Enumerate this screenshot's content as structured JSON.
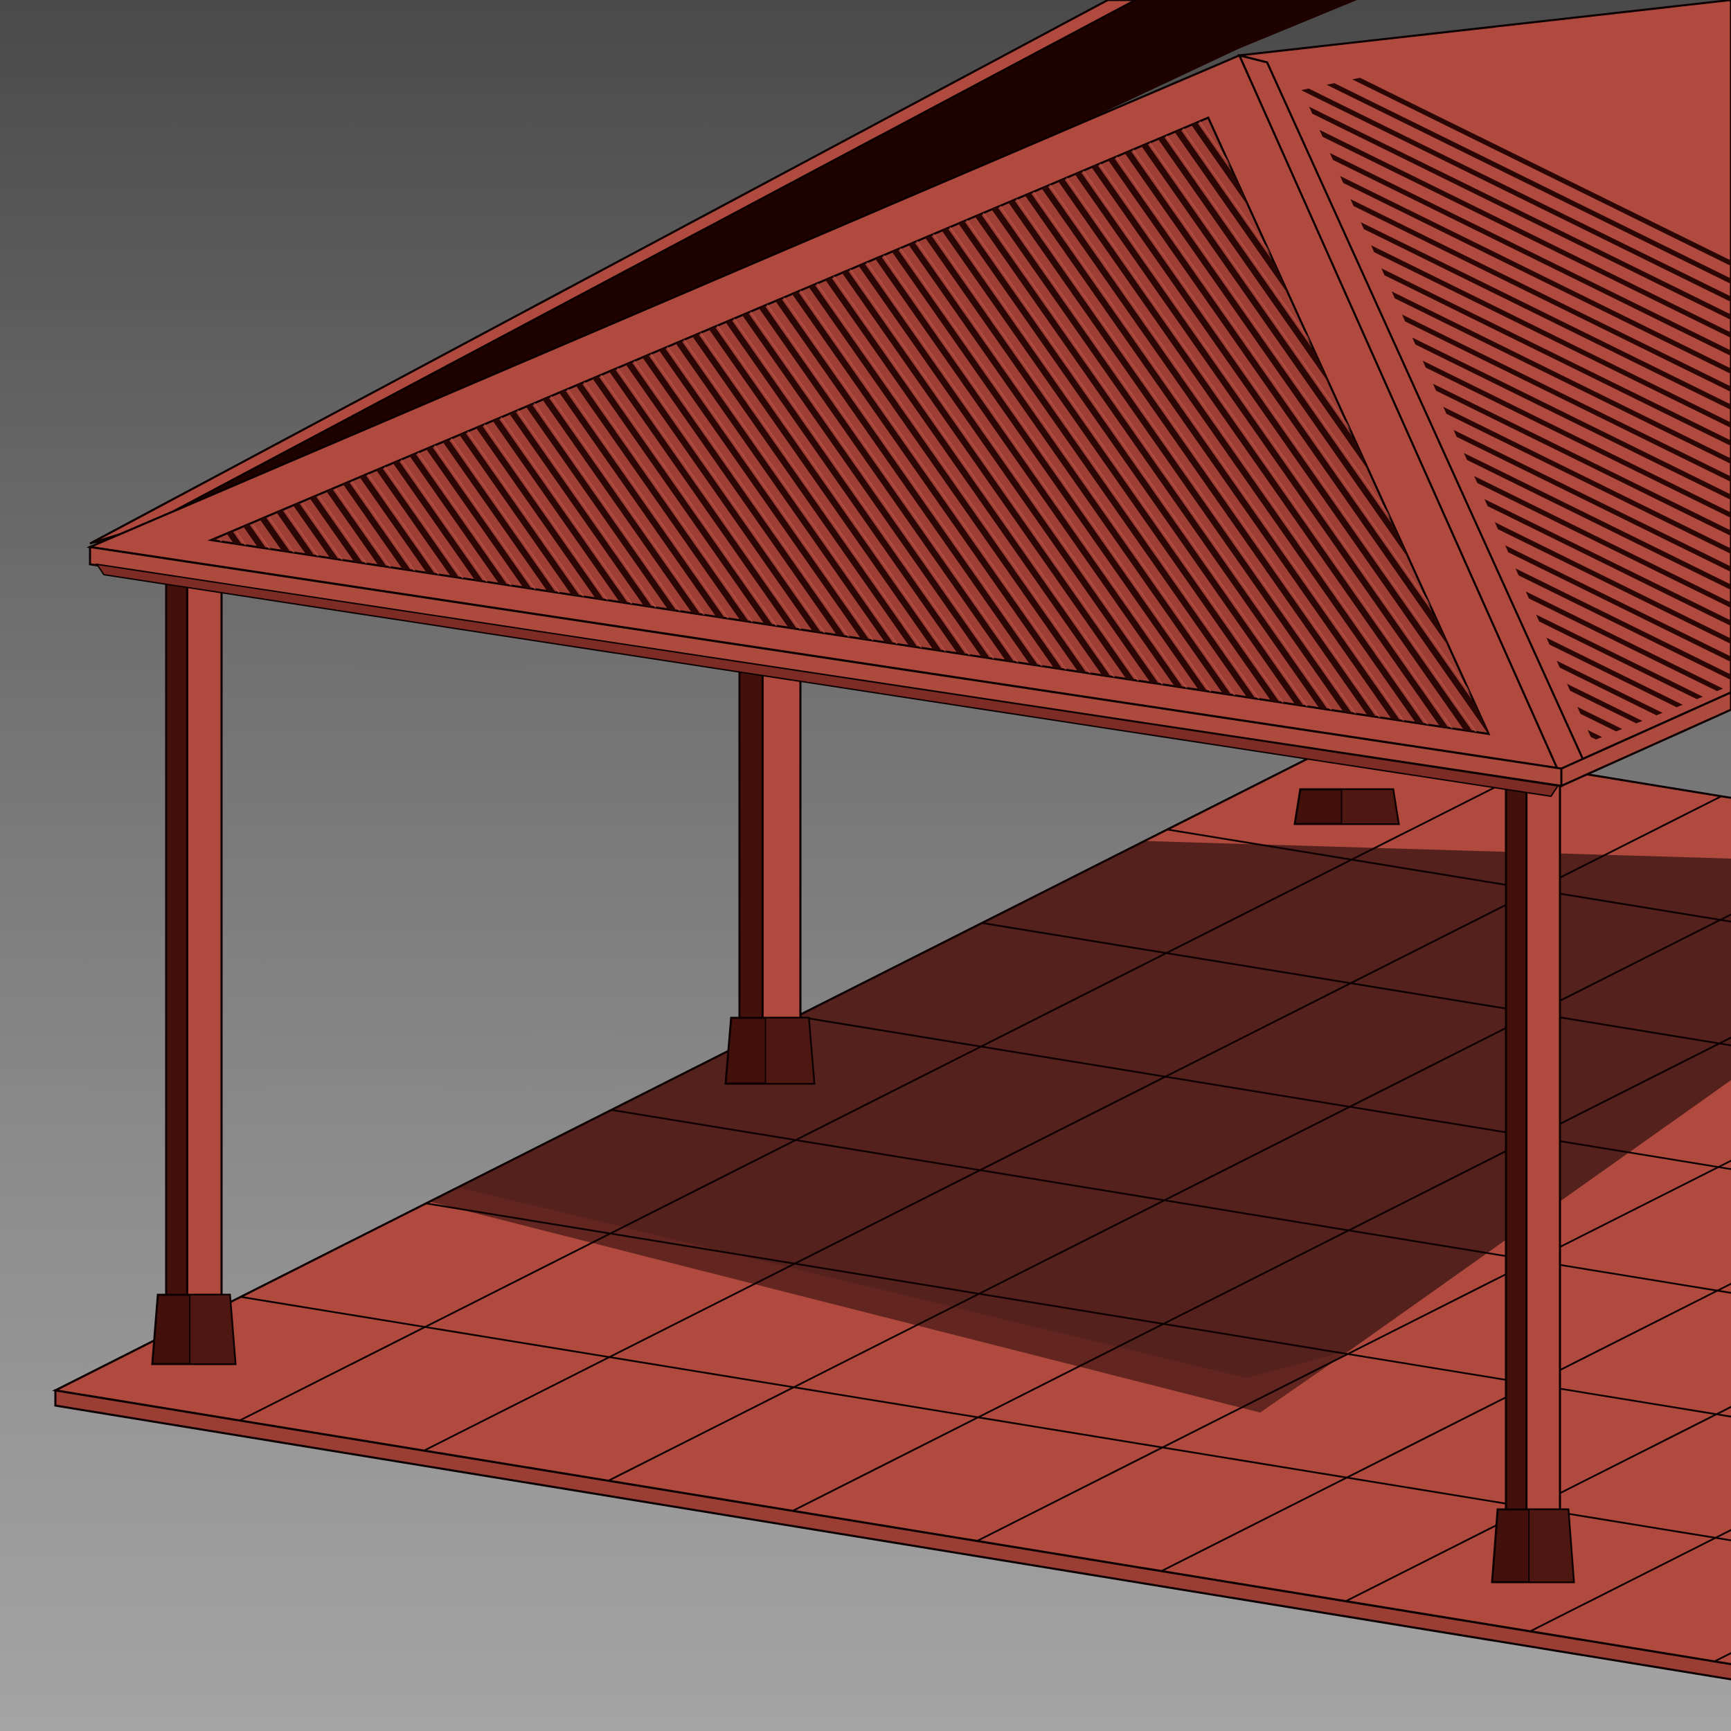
{
  "colors": {
    "bg_top": "#4a4a4a",
    "bg_bottom": "#a4a4a4",
    "roof_face": "#b04a3f",
    "roof_face_dark": "#9e3f36",
    "roof_groove": "#2a0604",
    "ridge_shadow": "#1e0200",
    "hip_ridge": "#b04a3f",
    "fascia": "#ad4a3e",
    "fascia_under": "#7c2c24",
    "post_front": "#b04a3f",
    "post_side": "#43100c",
    "slab_top": "#b04a3f",
    "slab_shadow": "#55211d",
    "slab_edge": "#9a3e34",
    "line": "#0d0000"
  }
}
